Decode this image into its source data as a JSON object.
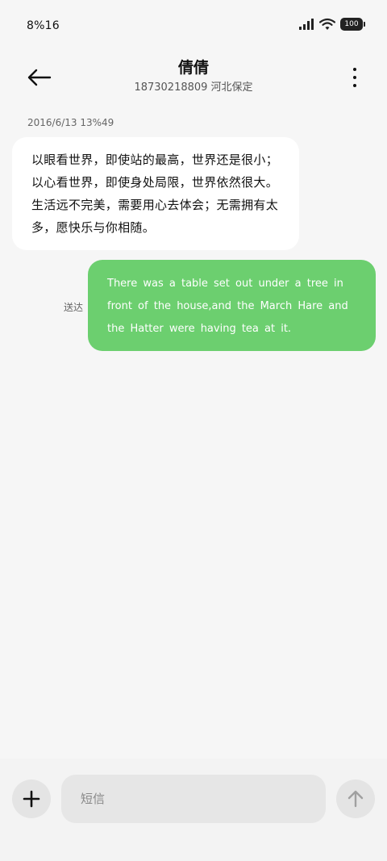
{
  "status_bar": {
    "time": "8%16",
    "battery": "100",
    "icons": [
      "signal-icon",
      "wifi-icon",
      "battery-icon"
    ]
  },
  "header": {
    "contact_name": "倩倩",
    "contact_detail": "18730218809 河北保定",
    "icons": [
      "back-arrow-icon",
      "more-vertical-icon"
    ]
  },
  "conversation": {
    "timestamp": "2016/6/13 13%49",
    "incoming_message": "以眼看世界，即使站的最高，世界还是很小；以心看世界，即使身处局限，世界依然很大。生活远不完美，需要用心去体会；无需拥有太多，愿快乐与你相随。",
    "outgoing_message": "There was a table set out under a tree in front of the house,and the March Hare and the Hatter were having tea at it.",
    "outgoing_status": "送达"
  },
  "composer": {
    "placeholder": "短信",
    "icons": [
      "plus-icon",
      "send-arrow-icon"
    ]
  },
  "colors": {
    "background": "#f6f6f6",
    "incoming_bubble": "#ffffff",
    "outgoing_bubble": "#6ccf6f",
    "input_background": "#e6e6e6"
  }
}
